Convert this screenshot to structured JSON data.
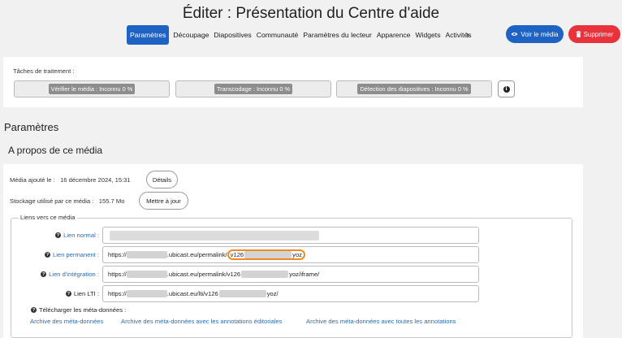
{
  "header": {
    "title": "Éditer : Présentation du Centre d'aide",
    "tabs": [
      {
        "label": "Paramètres",
        "active": true
      },
      {
        "label": "Découpage",
        "active": false
      },
      {
        "label": "Diapositives",
        "active": false
      },
      {
        "label": "Communauté",
        "active": false
      },
      {
        "label": "Paramètres du lecteur",
        "active": false
      },
      {
        "label": "Apparence",
        "active": false
      },
      {
        "label": "Widgets",
        "active": false
      },
      {
        "label": "Activités",
        "active": false
      }
    ],
    "tabs_more_icon": "chevron-right-icon",
    "view_button": {
      "label": "Voir le média",
      "icon": "eye-icon",
      "color": "#1e63c3"
    },
    "delete_button": {
      "label": "Supprimer",
      "icon": "trash-icon",
      "color": "#e8333c"
    }
  },
  "tasks": {
    "label": "Tâches de traitement :",
    "items": [
      {
        "label": "Vérifier le média : Inconnu 0 %"
      },
      {
        "label": "Transcodage : Inconnu 0 %"
      },
      {
        "label": "Détection des diapositives : Inconnu 0 %"
      }
    ],
    "info_icon": "info-icon"
  },
  "section_title": "Paramètres",
  "about": {
    "title": "A propos de ce média",
    "added_label": "Média ajouté le :",
    "added_value": "16 décembre 2024, 15:31",
    "details_button": "Détails",
    "storage_label": "Stockage utilisé par ce média :",
    "storage_value": "155.7 Mo",
    "update_button": "Mettre à jour"
  },
  "links": {
    "legend": "Liens vers ce média",
    "rows": [
      {
        "label": "Lien normal :",
        "value": ""
      },
      {
        "label": "Lien permanent :",
        "prefix": "https://",
        "mid": ".ubicast.eu/permalink/",
        "highlight_start": "v126",
        "highlight_end": "yoz"
      },
      {
        "label": "Lien d'intégration :",
        "prefix": "https://",
        "mid": ".ubicast.eu/permalink/v126",
        "suffix": "yoz/iframe/"
      },
      {
        "label": "Lien LTI :",
        "prefix": "https://",
        "mid": ".ubicast.eu/lti/v126",
        "suffix": "yoz/"
      }
    ],
    "download_label": "Télécharger les méta-données :",
    "downloads": [
      "Archive des méta-données",
      "Archive des méta-données avec les annotations éditoriales",
      "Archive des méta-données avec toutes les annotations"
    ],
    "link_color": "#2b6cb0",
    "highlight_color": "#f08a24"
  }
}
